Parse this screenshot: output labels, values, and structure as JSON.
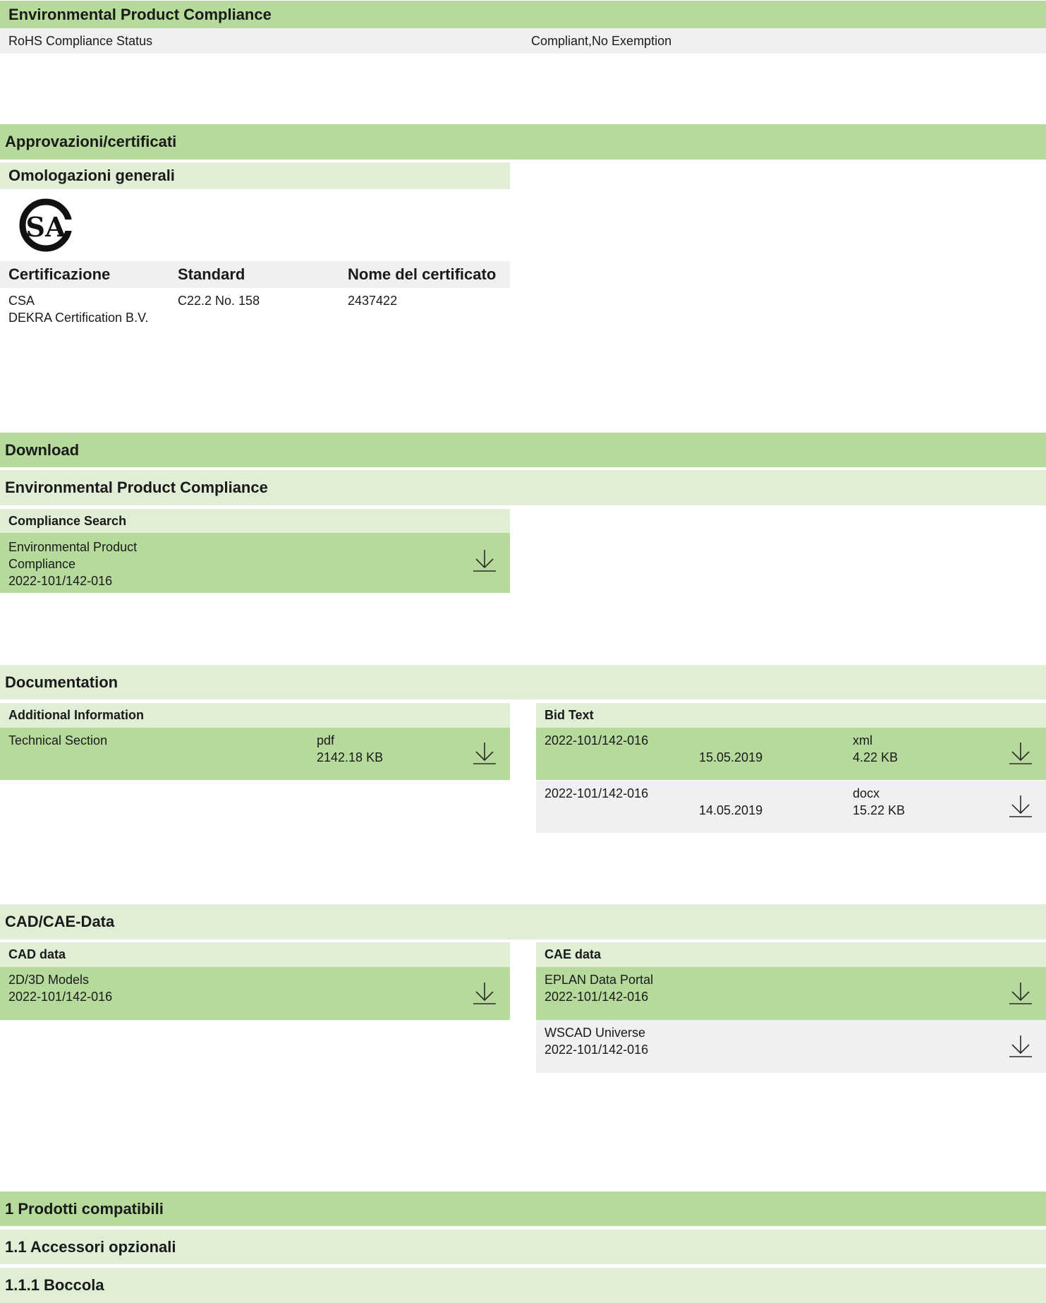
{
  "epc_section": {
    "title": "Environmental Product Compliance",
    "rohs_label": "RoHS Compliance Status",
    "rohs_value": "Compliant,No Exemption"
  },
  "approvals": {
    "title": "Approvazioni/certificati",
    "general_title": "Omologazioni generali",
    "logo_name": "CSA",
    "columns": [
      "Certificazione",
      "Standard",
      "Nome del certificato"
    ],
    "rows": [
      {
        "certification_line1": "CSA",
        "certification_line2": "DEKRA Certification B.V.",
        "standard": "C22.2 No. 158",
        "certificate_name": "2437422"
      }
    ]
  },
  "download": {
    "title": "Download",
    "sub_title": "Environmental Product Compliance",
    "box_title": "Compliance Search",
    "item_line1": "Environmental Product",
    "item_line2": "Compliance",
    "item_line3": "2022-101/142-016"
  },
  "documentation": {
    "title": "Documentation",
    "additional": {
      "title": "Additional Information",
      "item_name": "Technical Section",
      "item_type": "pdf",
      "item_size": "2142.18 KB"
    },
    "bid": {
      "title": "Bid Text",
      "items": [
        {
          "name": "2022-101/142-016",
          "date": "15.05.2019",
          "type": "xml",
          "size": "4.22 KB"
        },
        {
          "name": "2022-101/142-016",
          "date": "14.05.2019",
          "type": "docx",
          "size": "15.22 KB"
        }
      ]
    }
  },
  "cad": {
    "title": "CAD/CAE-Data",
    "cad_box": {
      "title": "CAD data",
      "item_line1": "2D/3D Models",
      "item_line2": "2022-101/142-016"
    },
    "cae_box": {
      "title": "CAE data",
      "items": [
        {
          "line1": "EPLAN Data Portal",
          "line2": "2022-101/142-016"
        },
        {
          "line1": "WSCAD Universe",
          "line2": "2022-101/142-016"
        }
      ]
    }
  },
  "compatible": {
    "title": "1 Prodotti compatibili",
    "sub_title": "1.1 Accessori opzionali",
    "sub_sub_title": "1.1.1 Boccola"
  },
  "colors": {
    "dark_green": "#b5da9b",
    "light_green": "#dfeed4",
    "grey_row": "#eff0f2"
  },
  "icons": {
    "download": "download-arrow-icon",
    "logo": "csa-logo-icon"
  }
}
